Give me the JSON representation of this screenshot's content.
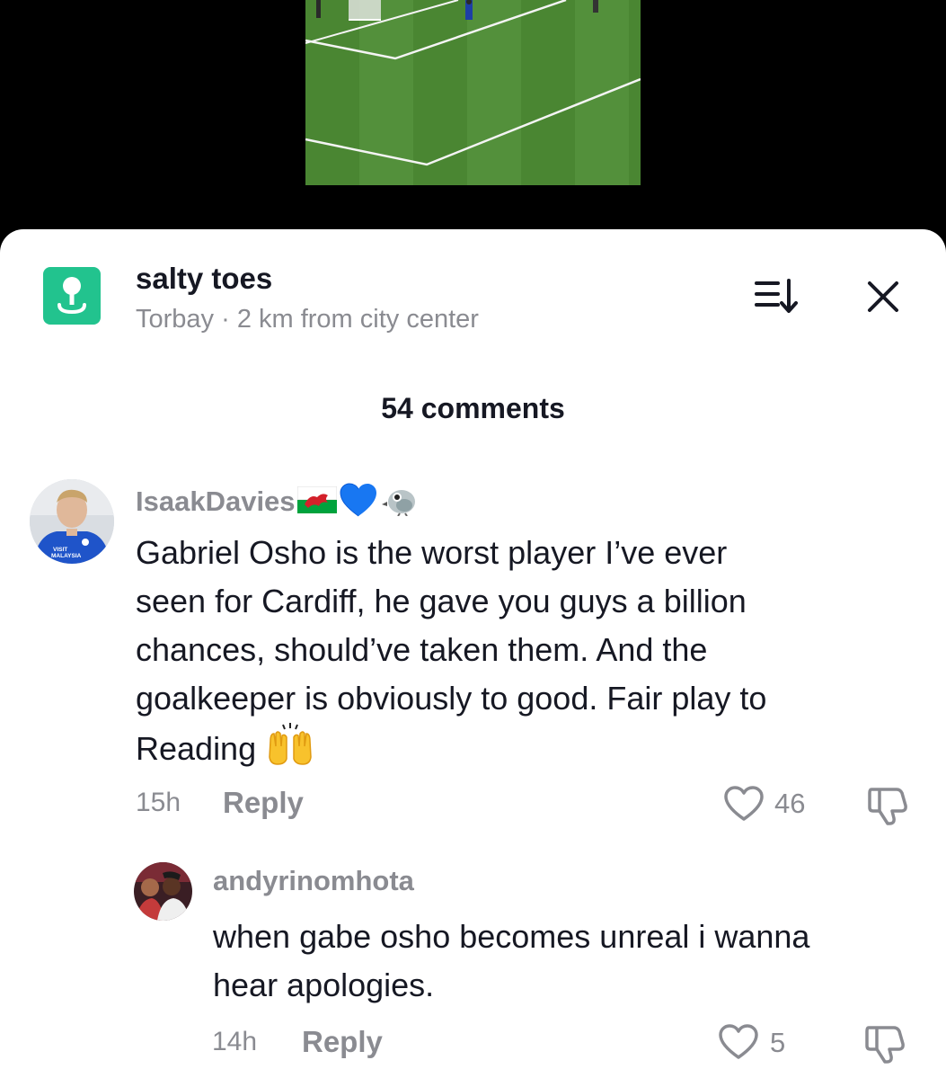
{
  "location": {
    "name": "salty toes",
    "subtitle": "Torbay · 2 km from city center"
  },
  "comments_header": "54 comments",
  "comments": [
    {
      "username": "IsaakDavies",
      "text_lines": [
        "Gabriel Osho is the worst player I’ve ever",
        "seen for Cardiff, he gave you guys a billion",
        "chances, should’ve taken them. And the",
        "goalkeeper is obviously to good. Fair play to",
        "Reading"
      ],
      "time": "15h",
      "reply_label": "Reply",
      "likes": "46",
      "avatar_text": [
        "VISIT",
        "MALAYSIA"
      ]
    },
    {
      "username": "andyrinomhota",
      "text_lines": [
        "when gabe osho becomes unreal i wanna",
        "hear apologies."
      ],
      "time": "14h",
      "reply_label": "Reply",
      "likes": "5"
    }
  ],
  "colors": {
    "accent_location": "#22c38e",
    "muted_text": "#8a8b91",
    "primary_text": "#161823"
  }
}
